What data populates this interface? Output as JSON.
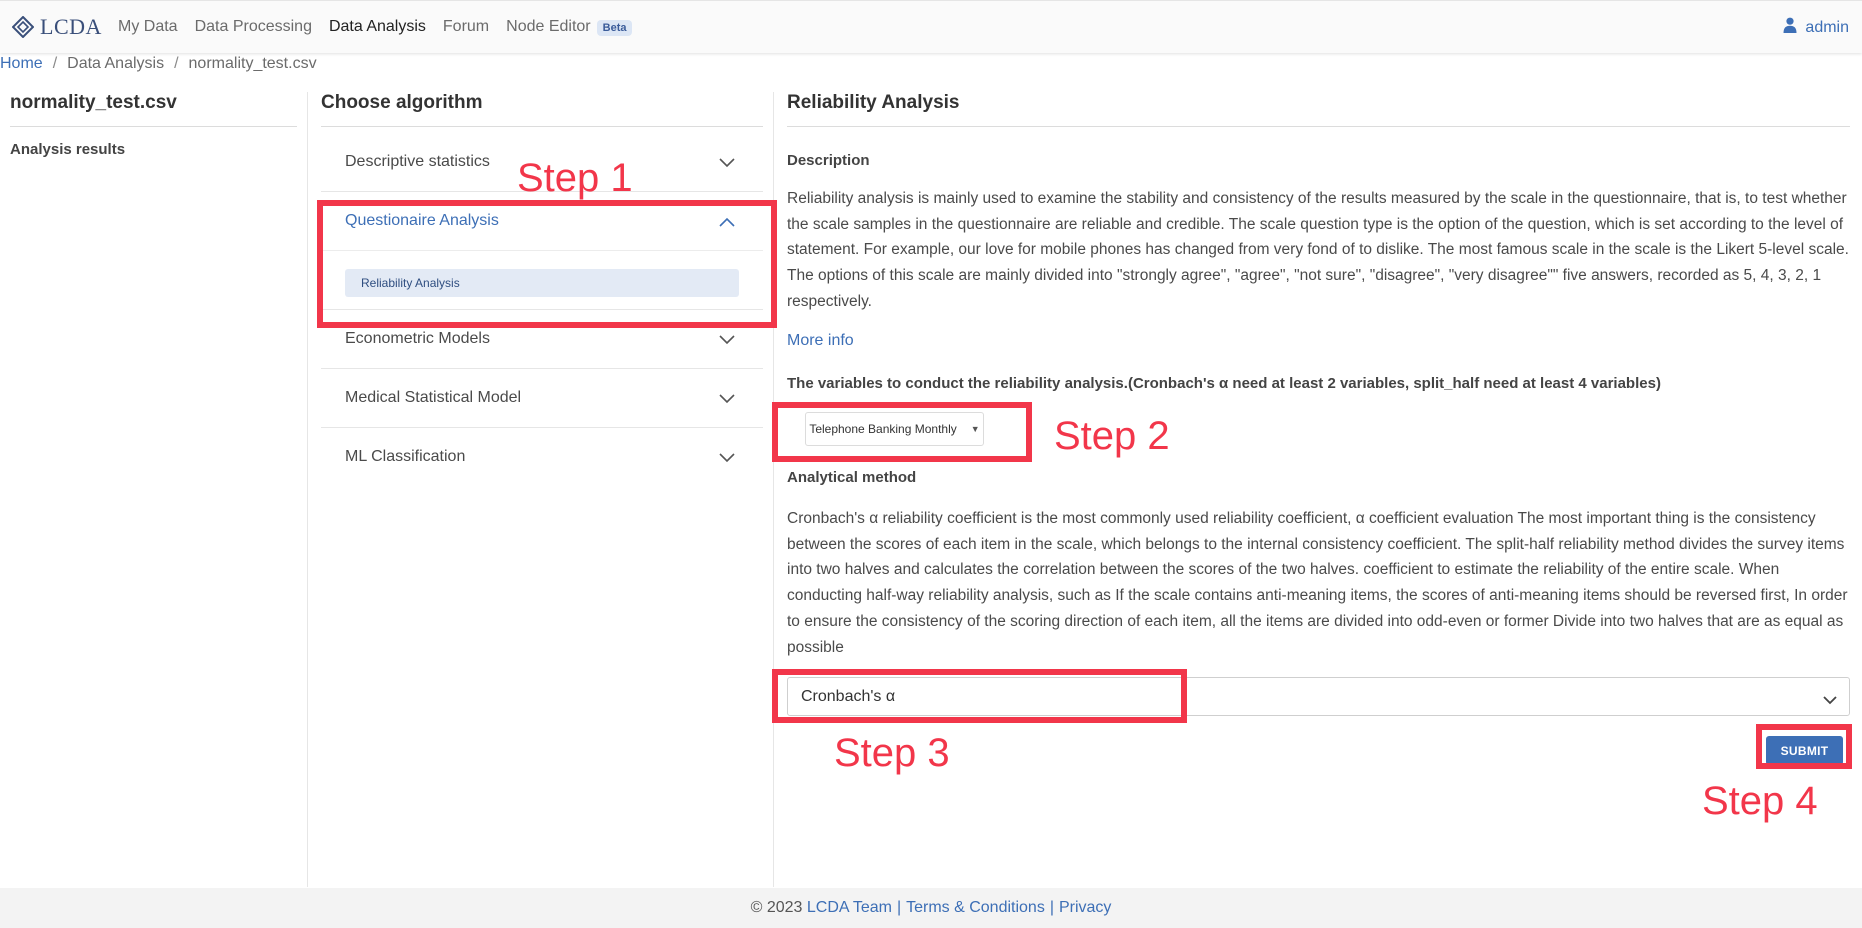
{
  "app": {
    "logo_text": "LCDA"
  },
  "nav": {
    "items": [
      {
        "label": "My Data"
      },
      {
        "label": "Data Processing"
      },
      {
        "label": "Data Analysis"
      },
      {
        "label": "Forum"
      },
      {
        "label": "Node Editor"
      }
    ],
    "active": "Data Analysis",
    "beta_badge": "Beta"
  },
  "user": {
    "name": "admin"
  },
  "breadcrumb": {
    "home": "Home",
    "section": "Data Analysis",
    "file": "normality_test.csv"
  },
  "left": {
    "file_title": "normality_test.csv",
    "analysis_results": "Analysis results"
  },
  "middle": {
    "title": "Choose algorithm",
    "accordion": [
      {
        "label": "Descriptive statistics",
        "expanded": false
      },
      {
        "label": "Questionaire Analysis",
        "expanded": true,
        "sub_items": [
          "Reliability Analysis"
        ]
      },
      {
        "label": "Econometric Models",
        "expanded": false
      },
      {
        "label": "Medical Statistical Model",
        "expanded": false
      },
      {
        "label": "ML Classification",
        "expanded": false
      }
    ]
  },
  "right": {
    "title": "Reliability Analysis",
    "description_label": "Description",
    "description": "Reliability analysis is mainly used to examine the stability and consistency of the results measured by the scale in the questionnaire, that is, to test whether the scale samples in the questionnaire are reliable and credible. The scale question type is the option of the question, which is set according to the level of statement. For example, our love for mobile phones has changed from very fond of to dislike. The most famous scale in the scale is the Likert 5-level scale. The options of this scale are mainly divided into \"strongly agree\", \"agree\", \"not sure\", \"disagree\", \"very disagree\"\" five answers, recorded as 5, 4, 3, 2, 1 respectively.",
    "more_info": "More info",
    "variables_label": "The variables to conduct the reliability analysis.(Cronbach's α need at least 2 variables, split_half need at least 4 variables)",
    "variable_dropdown": "Telephone Banking Monthly",
    "method_label": "Analytical method",
    "method_description": "Cronbach's α reliability coefficient is the most commonly used reliability coefficient, α coefficient evaluation The most important thing is the consistency between the scores of each item in the scale, which belongs to the internal consistency coefficient. The split-half reliability method divides the survey items into two halves and calculates the correlation between the scores of the two halves. coefficient to estimate the reliability of the entire scale. When conducting half-way reliability analysis, such as If the scale contains anti-meaning items, the scores of anti-meaning items should be reversed first, In order to ensure the consistency of the scoring direction of each item, all the items are divided into odd-even or former Divide into two halves that are as equal as possible",
    "method_select_value": "Cronbach's α",
    "submit_label": "SUBMIT"
  },
  "annotations": {
    "step1": "Step 1",
    "step2": "Step 2",
    "step3": "Step 3",
    "step4": "Step 4"
  },
  "footer": {
    "copyright": "© 2023",
    "team": "LCDA Team",
    "terms": "Terms & Conditions",
    "privacy": "Privacy",
    "separator": "|"
  },
  "colors": {
    "accent": "#3d6fb6",
    "annotation_red": "#f2364a",
    "footer_bg": "#f3f3f3"
  }
}
